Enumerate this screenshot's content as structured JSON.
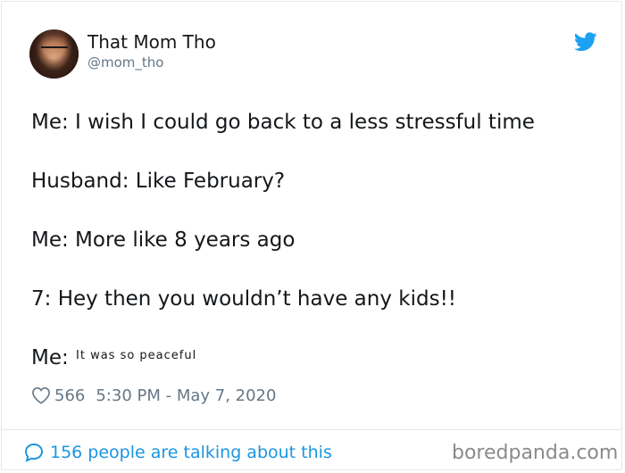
{
  "author": {
    "name": "That Mom Tho",
    "handle": "@mom_tho"
  },
  "tweet": {
    "lines": [
      "Me: I wish I could go back to a less stressful time",
      "Husband: Like February?",
      "Me: More like 8 years ago",
      "7: Hey then you wouldn’t have any kids!!",
      "Me:"
    ],
    "small_text": "It was so peaceful"
  },
  "meta": {
    "likes": "566",
    "timestamp": "5:30 PM - May 7, 2020"
  },
  "footer": {
    "talking": "156 people are talking about this",
    "watermark": "boredpanda.com"
  },
  "icons": {
    "bird": "twitter-bird-icon",
    "heart": "heart-outline-icon",
    "bubble": "speech-bubble-icon"
  },
  "colors": {
    "brand": "#1da1f2",
    "link": "#1b95e0",
    "muted": "#657786"
  }
}
